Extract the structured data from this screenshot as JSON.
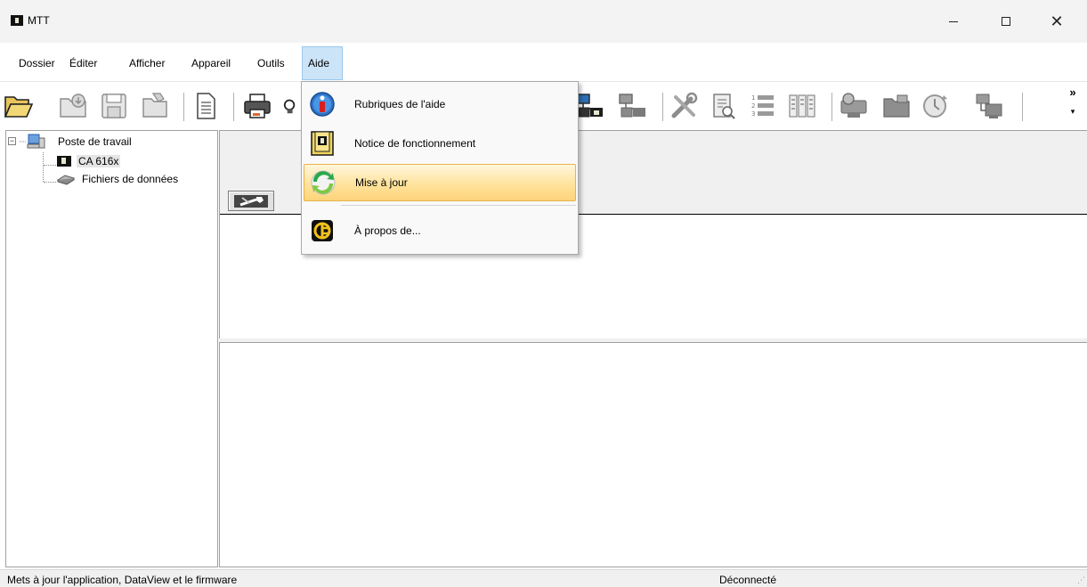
{
  "window": {
    "title": "MTT",
    "minimize_glyph": "—",
    "close_glyph": "✕"
  },
  "menubar": {
    "items": [
      {
        "label": "Dossier"
      },
      {
        "label": "Éditer"
      },
      {
        "label": "Afficher"
      },
      {
        "label": "Appareil"
      },
      {
        "label": "Outils"
      },
      {
        "label": "Aide",
        "active": true
      }
    ]
  },
  "toolbar": {
    "icons": [
      "open-folder-icon",
      "download-folder-icon",
      "save-icon",
      "folder-icon",
      "document-icon",
      "print-icon",
      "print-preview-icon",
      "network-connect-icon",
      "network-disconnect-icon",
      "tools-icon",
      "report-icon",
      "numbered-list-icon",
      "columns-icon",
      "instrument-download-icon",
      "instrument-folder-icon",
      "clock-icon",
      "transfer-icon"
    ],
    "overflow_glyph": "»",
    "overflow_arrow": "▾"
  },
  "tree": {
    "root": {
      "label": "Poste de travail",
      "expander": "−"
    },
    "children": [
      {
        "label": "CA 616x",
        "selected": true
      },
      {
        "label": "Fichiers de données"
      }
    ]
  },
  "help_menu": {
    "items": [
      {
        "label": "Rubriques de l'aide",
        "icon": "info-icon"
      },
      {
        "label": "Notice de fonctionnement",
        "icon": "manual-icon"
      },
      {
        "label": "Mise à jour",
        "icon": "update-icon",
        "highlighted": true
      },
      {
        "label": "À propos de...",
        "icon": "about-logo-icon"
      }
    ]
  },
  "statusbar": {
    "message": "Mets à jour l'application, DataView et le firmware",
    "connection": "Déconnecté"
  },
  "colors": {
    "menu_active_bg": "#cce4f7",
    "highlight_gradient_top": "#fff6dc",
    "highlight_gradient_bottom": "#fdd37a",
    "panel_band": "#f0f0f0"
  }
}
